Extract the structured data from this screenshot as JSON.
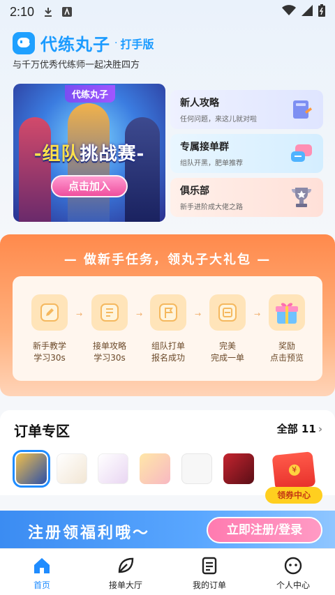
{
  "status_bar": {
    "time": "2:10"
  },
  "header": {
    "app_name": "代练丸子",
    "dot": "·",
    "edition": "打手版",
    "slogan": "与千万优秀代练师一起决胜四方"
  },
  "banner": {
    "tag": "代练丸子",
    "title_left": "-组队",
    "title_right": "挑战赛-",
    "join_label": "点击加入"
  },
  "cards": [
    {
      "title": "新人攻略",
      "subtitle": "任何问题，来这儿就对啦",
      "icon": "book-icon"
    },
    {
      "title": "专属接单群",
      "subtitle": "组队开黑，肥单推荐",
      "icon": "chat-bubbles-icon"
    },
    {
      "title": "俱乐部",
      "subtitle": "新手进阶成大佬之路",
      "icon": "trophy-icon"
    }
  ],
  "task": {
    "heading": "— 做新手任务，领丸子大礼包 —",
    "steps": [
      {
        "line1": "新手教学",
        "line2": "学习30s",
        "icon": "pencil-icon"
      },
      {
        "line1": "接单攻略",
        "line2": "学习30s",
        "icon": "document-icon"
      },
      {
        "line1": "组队打单",
        "line2": "报名成功",
        "icon": "flag-icon"
      },
      {
        "line1": "完美",
        "line2": "完成一单",
        "icon": "checklist-icon"
      },
      {
        "line1": "奖励",
        "line2": "点击预览",
        "icon": "gift-icon"
      }
    ],
    "arrow": "→"
  },
  "orders": {
    "title": "订单专区",
    "all_label": "全部 11",
    "chevron": "›",
    "games": [
      {
        "name": "game-icon-1",
        "color": "#2c4fa8"
      },
      {
        "name": "game-icon-2",
        "color": "#f2e6d4"
      },
      {
        "name": "game-icon-3",
        "color": "#e9d6f2"
      },
      {
        "name": "game-icon-4",
        "color": "#f8d6c2"
      },
      {
        "name": "game-icon-5",
        "color": "#f2f2f2"
      },
      {
        "name": "game-icon-6",
        "color": "#c4242f"
      }
    ],
    "coupon_label": "领券中心"
  },
  "register": {
    "text": "注册领福利哦～",
    "button": "立即注册/登录"
  },
  "nav": {
    "items": [
      {
        "label": "首页",
        "icon": "home-icon"
      },
      {
        "label": "接单大厅",
        "icon": "leaf-icon"
      },
      {
        "label": "我的订单",
        "icon": "order-list-icon"
      },
      {
        "label": "个人中心",
        "icon": "profile-face-icon"
      }
    ]
  },
  "colors": {
    "accent": "#1f8cff",
    "task_orange": "#ff8a4c",
    "brand": "#1b9bff"
  }
}
